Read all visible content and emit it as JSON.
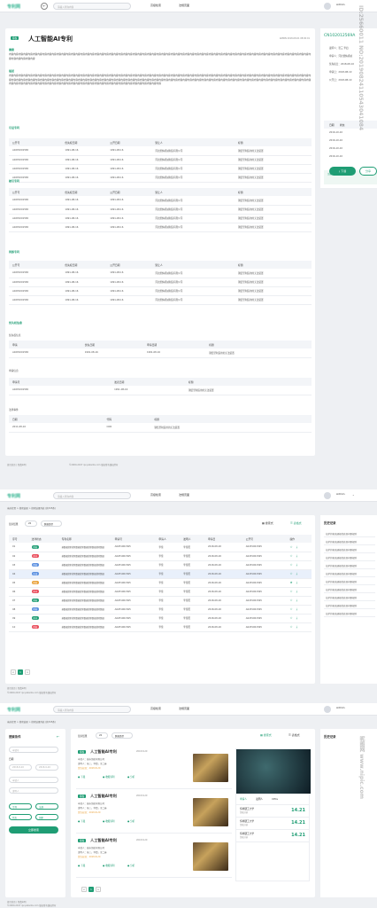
{
  "brand": {
    "logo": "专利网"
  },
  "search": {
    "placeholder": "请输入查询内容"
  },
  "nav": {
    "link1": "高级检索",
    "link2": "法规页面",
    "user": "Admin"
  },
  "detail": {
    "tag": "授权",
    "title": "人工智能AI专利",
    "meta": "ADMIN 2018-08-01 08:00:01",
    "abstract_label": "摘要",
    "abstract": "内容内容内容内容内容内容内容内容内容内容内容内容内容内容内容内容内容内容内容内容内容内容内容内容内容内容内容内容内容内容内容内容内容内容内容内容内容内容内容内容内容内容内容内容内容内容内容内容内容内容内容内容内容内容内容内容内容内容内容内容内容内容内容内容内容内容内容内容内容",
    "desc_label": "描述",
    "desc": "内容内容内容内容内容内容内容内容内容内容内容内容内容内容内容内容内容内容内容内容内容内容内容内容内容内容内容内容内容内容内容内容内容内容内容内容内容内容内容内容内容内容内容内容内容内容内容内容内容内容内容内容内容内容内容内容内容内容内容内容内容内容内容内容内容内容内容内容内容内容内容内容内容内容内容内容内容内容内容内容内容内容内容内容内容内容内容内容内容内容内容内容内容内容内容内容内容内容内容内容内容内容内容内容内容内容内容内容内容内容内容内容内容内容内容内容内容内容内容内容内容内容内容内容内容内容内容内容内容内容内容内容内容内容内容内容内容内容内容内容内容内容内容内容内容内容内容内容内容内容内容内容内容内容内容内容内容内容内容",
    "cited_label": "引证专利",
    "cite_label": "被引专利",
    "family_label": "同族专利",
    "priority_label": "优先权信息",
    "priority_sub": "优先权信息",
    "app_sub": "申请信息",
    "law_label": "法律事件",
    "cols": [
      "公开号",
      "优先权日期",
      "公开日期",
      "受让人",
      "标题"
    ],
    "row": [
      "A02P1001565",
      "1991-08-16",
      "1991-08-16",
      "河北蕾纳机械制造有限公司",
      "钢结型制造用的无法装置"
    ],
    "prio_cols": [
      "申请",
      "优先日期",
      "申请日期",
      "标题"
    ],
    "prio_row": [
      "A02P1001565",
      "1991-08-16",
      "1991-08-16",
      "钢结型制造用的无法装置"
    ],
    "app_cols": [
      "申请号",
      "",
      "发表日期",
      "标题"
    ],
    "app_row": [
      "A02P1001565",
      "",
      "1991-08-16",
      "钢结型制造用的无法装置"
    ],
    "law_cols": [
      "日期",
      "代码",
      "标题"
    ],
    "law_row": [
      "2011-08-10",
      "COR",
      "钢结型制造用的无法装置"
    ]
  },
  "side": {
    "number": "CN102012569A",
    "fields": [
      "发明人：",
      "申请人：",
      "优先权日：",
      "申请日：",
      "公开日："
    ],
    "values": [
      "张三 李四",
      "河北蕾纳机械",
      "2018-08-10",
      "2018-08-10",
      "2018-08-10"
    ],
    "date_col": "日期",
    "status_col": "状态",
    "dates": [
      "2016-10-10",
      "2016-10-10",
      "2016-10-10",
      "2016-10-10"
    ],
    "note": "注册 专利状态为…提供。",
    "download": "下载",
    "share": "分享"
  },
  "footer": {
    "left": "首页首页 | 免费声明",
    "right": "©2000-2017 ipc-patents.com 版权所有版权所有"
  },
  "list": {
    "breadcrumb": "当前位置 > 搜索结果 > 搜索结果列表 (共345条)",
    "per_page_label": "显示结果",
    "per_page": "20",
    "sort": "数据类型",
    "view1": "搜索式",
    "view2": "表格式",
    "cols": [
      "序号",
      "法律状态",
      "专利名称",
      "申请号",
      "申请人",
      "发明人",
      "申请日",
      "公开号",
      "操作"
    ],
    "nums": [
      "01",
      "02",
      "03",
      "04",
      "05",
      "06",
      "07",
      "08",
      "09",
      "10"
    ],
    "statuses": [
      "授权",
      "审中",
      "授权",
      "失效",
      "授权",
      "审中",
      "授权",
      "授权",
      "审中",
      "授权"
    ],
    "status_colors": [
      "#1f9d74",
      "#e94b5a",
      "#5a8fe0",
      "#5a8fe0",
      "#e9a23b",
      "#e94b5a",
      "#1f9d74",
      "#5a8fe0",
      "#1f9d74",
      "#e94b5a"
    ],
    "name": "基数据搜索搜索数据搜索数据搜索数据搜索数据",
    "appno": "A02P1001565",
    "applicant": "李佳",
    "inventor": "李佳阳",
    "date": "2018-08-20",
    "pub": "A02P1001565",
    "history_title": "历史记录",
    "history": [
      "拉萨的客流通规律表现问题规则",
      "拉萨的客流通规律表现问题规则",
      "拉萨的客流通规律表现问题规则",
      "拉萨的客流通规律表现问题规则",
      "拉萨的客流通规律表现问题规则",
      "拉萨的客流通规律表现问题规则",
      "拉萨的客流通规律表现问题规则",
      "拉萨的客流通规律表现问题规则",
      "拉萨的客流通规律表现问题规则",
      "拉萨的客流通规律表现问题规则",
      "拉萨的客流通规律表现问题规则"
    ],
    "pages": [
      "<",
      "1",
      ">"
    ]
  },
  "cards": {
    "breadcrumb": "当前位置 > 搜索结果 > 搜索结果列表 (共345条)",
    "filter_title": "搜索条件",
    "fields": [
      "申请号",
      "日期",
      "申请人",
      "发明人"
    ],
    "date_from": "2018-8-20",
    "date_to": "2018-9-20",
    "pills": [
      "专利",
      "法规",
      "状态",
      "国家"
    ],
    "submit": "立即搜索",
    "items": [
      {
        "tag": "授权",
        "title": "人工智能AI专利",
        "date": "2018-8-20",
        "l1": "申请人：城市领航有限公司",
        "l2": "发明人：张三，李四，王二麻",
        "l3": "优先权日：2018-8-20",
        "actions": [
          "下载",
          "收藏专利",
          "分析"
        ]
      },
      {
        "tag": "授权",
        "title": "人工智能AI专利",
        "date": "2018-8-20",
        "l1": "申请人：城市领航有限公司",
        "l2": "发明人：张三，李四，王二麻",
        "l3": "优先权日：2018-8-20",
        "actions": [
          "下载",
          "收藏专利",
          "分析"
        ]
      },
      {
        "tag": "授权",
        "title": "人工智能AI专利",
        "date": "2018-8-20",
        "l1": "申请人：城市领航有限公司",
        "l2": "发明人：张三，李四，王二麻",
        "l3": "优先权日：2018-8-20",
        "actions": [
          "下载",
          "收藏专利",
          "分析"
        ]
      }
    ],
    "preview_tabs": [
      "申请人",
      "发明人",
      "CPCs"
    ],
    "preview_rows": [
      {
        "name": "恒祥硬工大学",
        "sub": "领域分析",
        "num": "14.21"
      },
      {
        "name": "恒祥硬工大学",
        "sub": "领域分析",
        "num": "14.21"
      },
      {
        "name": "恒祥硬工大学",
        "sub": "领域分析",
        "num": "14.21"
      }
    ],
    "history_title": "历史记录",
    "pages": [
      "<",
      "1",
      ">"
    ]
  },
  "watermark": {
    "text1": "昵图网 www.nipic.com",
    "text2": "ID:25660011 NO:20190824110543041084"
  }
}
